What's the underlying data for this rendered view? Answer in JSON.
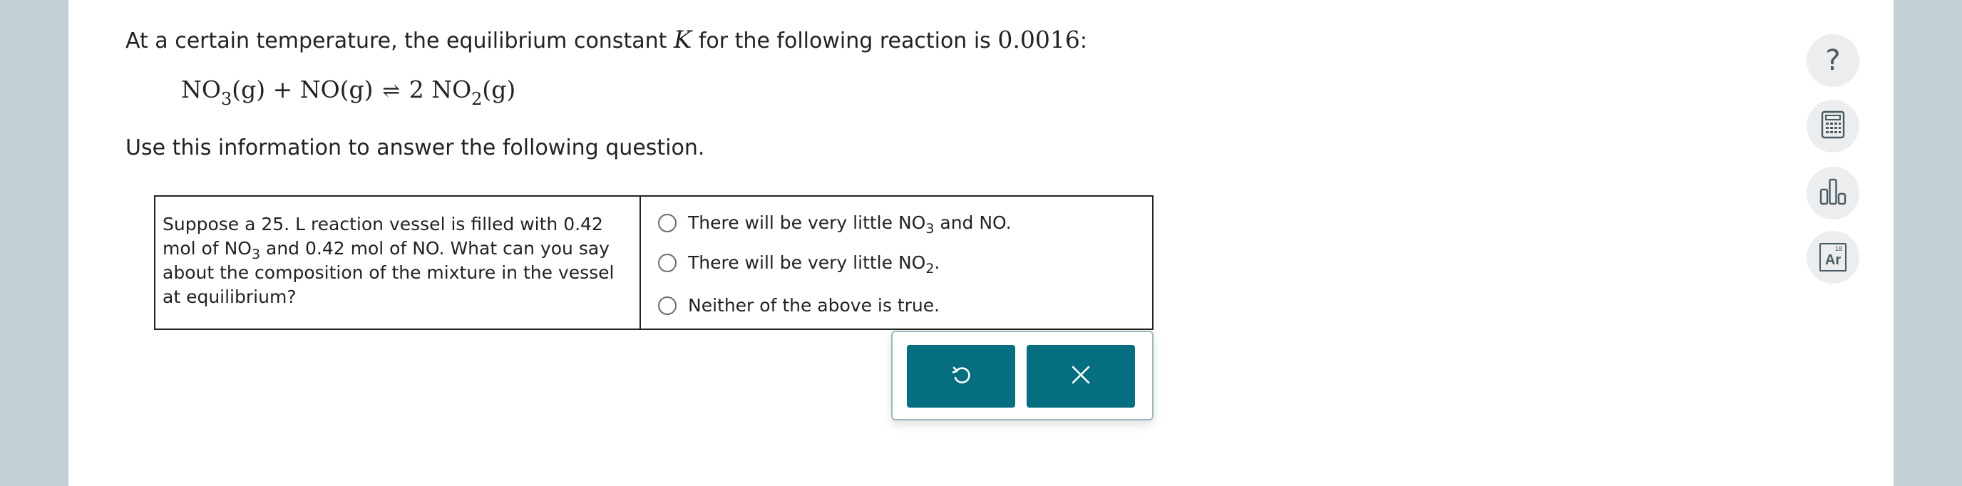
{
  "problem": {
    "intro_before_k": "At a certain temperature, the equilibrium constant",
    "k_symbol": "K",
    "intro_after_k": "for the following reaction is",
    "k_value": "0.0016",
    "intro_end": ":",
    "equation": {
      "reactant1": "NO",
      "reactant1_sub": "3",
      "reactant1_state": "(g)",
      "plus": "+",
      "reactant2": "NO(g)",
      "arrow": "⇌",
      "product_coef": "2",
      "product": "NO",
      "product_sub": "2",
      "product_state": "(g)"
    },
    "instruction": "Use this information to answer the following question."
  },
  "question": {
    "part1": "Suppose a 25. L reaction vessel is filled with 0.42 mol of NO",
    "sub": "3",
    "part2": "and 0.42 mol of NO. What can you say about the composition of the mixture in the vessel at equilibrium?"
  },
  "options": [
    {
      "before": "There will be very little NO",
      "sub": "3",
      "after": " and NO."
    },
    {
      "before": "There will be very little NO",
      "sub": "2",
      "after": "."
    },
    {
      "before": "Neither of the above is true.",
      "sub": "",
      "after": ""
    }
  ],
  "actions": {
    "undo_icon": "undo-icon",
    "clear_icon": "close-icon",
    "accent": "#056e80"
  },
  "tools": {
    "help_glyph": "?",
    "periodic_table": {
      "number": "18",
      "symbol": "Ar"
    }
  }
}
